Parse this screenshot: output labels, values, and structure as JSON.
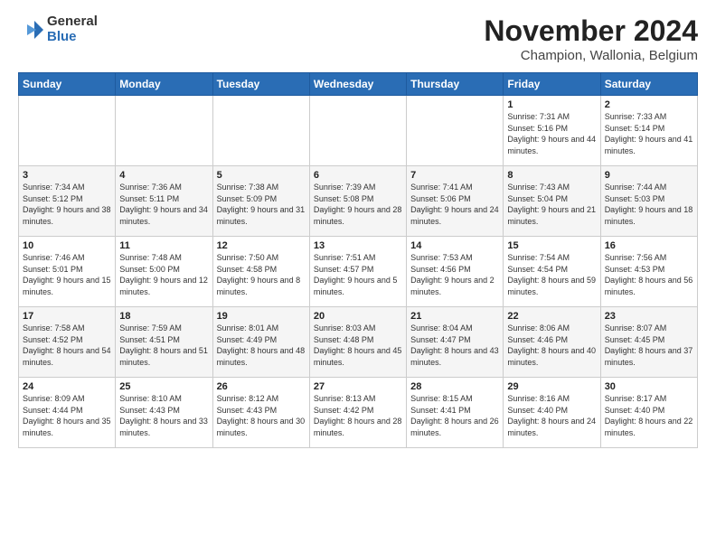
{
  "logo": {
    "general": "General",
    "blue": "Blue"
  },
  "title": "November 2024",
  "location": "Champion, Wallonia, Belgium",
  "weekdays": [
    "Sunday",
    "Monday",
    "Tuesday",
    "Wednesday",
    "Thursday",
    "Friday",
    "Saturday"
  ],
  "weeks": [
    [
      {
        "day": "",
        "info": ""
      },
      {
        "day": "",
        "info": ""
      },
      {
        "day": "",
        "info": ""
      },
      {
        "day": "",
        "info": ""
      },
      {
        "day": "",
        "info": ""
      },
      {
        "day": "1",
        "info": "Sunrise: 7:31 AM\nSunset: 5:16 PM\nDaylight: 9 hours and 44 minutes."
      },
      {
        "day": "2",
        "info": "Sunrise: 7:33 AM\nSunset: 5:14 PM\nDaylight: 9 hours and 41 minutes."
      }
    ],
    [
      {
        "day": "3",
        "info": "Sunrise: 7:34 AM\nSunset: 5:12 PM\nDaylight: 9 hours and 38 minutes."
      },
      {
        "day": "4",
        "info": "Sunrise: 7:36 AM\nSunset: 5:11 PM\nDaylight: 9 hours and 34 minutes."
      },
      {
        "day": "5",
        "info": "Sunrise: 7:38 AM\nSunset: 5:09 PM\nDaylight: 9 hours and 31 minutes."
      },
      {
        "day": "6",
        "info": "Sunrise: 7:39 AM\nSunset: 5:08 PM\nDaylight: 9 hours and 28 minutes."
      },
      {
        "day": "7",
        "info": "Sunrise: 7:41 AM\nSunset: 5:06 PM\nDaylight: 9 hours and 24 minutes."
      },
      {
        "day": "8",
        "info": "Sunrise: 7:43 AM\nSunset: 5:04 PM\nDaylight: 9 hours and 21 minutes."
      },
      {
        "day": "9",
        "info": "Sunrise: 7:44 AM\nSunset: 5:03 PM\nDaylight: 9 hours and 18 minutes."
      }
    ],
    [
      {
        "day": "10",
        "info": "Sunrise: 7:46 AM\nSunset: 5:01 PM\nDaylight: 9 hours and 15 minutes."
      },
      {
        "day": "11",
        "info": "Sunrise: 7:48 AM\nSunset: 5:00 PM\nDaylight: 9 hours and 12 minutes."
      },
      {
        "day": "12",
        "info": "Sunrise: 7:50 AM\nSunset: 4:58 PM\nDaylight: 9 hours and 8 minutes."
      },
      {
        "day": "13",
        "info": "Sunrise: 7:51 AM\nSunset: 4:57 PM\nDaylight: 9 hours and 5 minutes."
      },
      {
        "day": "14",
        "info": "Sunrise: 7:53 AM\nSunset: 4:56 PM\nDaylight: 9 hours and 2 minutes."
      },
      {
        "day": "15",
        "info": "Sunrise: 7:54 AM\nSunset: 4:54 PM\nDaylight: 8 hours and 59 minutes."
      },
      {
        "day": "16",
        "info": "Sunrise: 7:56 AM\nSunset: 4:53 PM\nDaylight: 8 hours and 56 minutes."
      }
    ],
    [
      {
        "day": "17",
        "info": "Sunrise: 7:58 AM\nSunset: 4:52 PM\nDaylight: 8 hours and 54 minutes."
      },
      {
        "day": "18",
        "info": "Sunrise: 7:59 AM\nSunset: 4:51 PM\nDaylight: 8 hours and 51 minutes."
      },
      {
        "day": "19",
        "info": "Sunrise: 8:01 AM\nSunset: 4:49 PM\nDaylight: 8 hours and 48 minutes."
      },
      {
        "day": "20",
        "info": "Sunrise: 8:03 AM\nSunset: 4:48 PM\nDaylight: 8 hours and 45 minutes."
      },
      {
        "day": "21",
        "info": "Sunrise: 8:04 AM\nSunset: 4:47 PM\nDaylight: 8 hours and 43 minutes."
      },
      {
        "day": "22",
        "info": "Sunrise: 8:06 AM\nSunset: 4:46 PM\nDaylight: 8 hours and 40 minutes."
      },
      {
        "day": "23",
        "info": "Sunrise: 8:07 AM\nSunset: 4:45 PM\nDaylight: 8 hours and 37 minutes."
      }
    ],
    [
      {
        "day": "24",
        "info": "Sunrise: 8:09 AM\nSunset: 4:44 PM\nDaylight: 8 hours and 35 minutes."
      },
      {
        "day": "25",
        "info": "Sunrise: 8:10 AM\nSunset: 4:43 PM\nDaylight: 8 hours and 33 minutes."
      },
      {
        "day": "26",
        "info": "Sunrise: 8:12 AM\nSunset: 4:43 PM\nDaylight: 8 hours and 30 minutes."
      },
      {
        "day": "27",
        "info": "Sunrise: 8:13 AM\nSunset: 4:42 PM\nDaylight: 8 hours and 28 minutes."
      },
      {
        "day": "28",
        "info": "Sunrise: 8:15 AM\nSunset: 4:41 PM\nDaylight: 8 hours and 26 minutes."
      },
      {
        "day": "29",
        "info": "Sunrise: 8:16 AM\nSunset: 4:40 PM\nDaylight: 8 hours and 24 minutes."
      },
      {
        "day": "30",
        "info": "Sunrise: 8:17 AM\nSunset: 4:40 PM\nDaylight: 8 hours and 22 minutes."
      }
    ]
  ]
}
